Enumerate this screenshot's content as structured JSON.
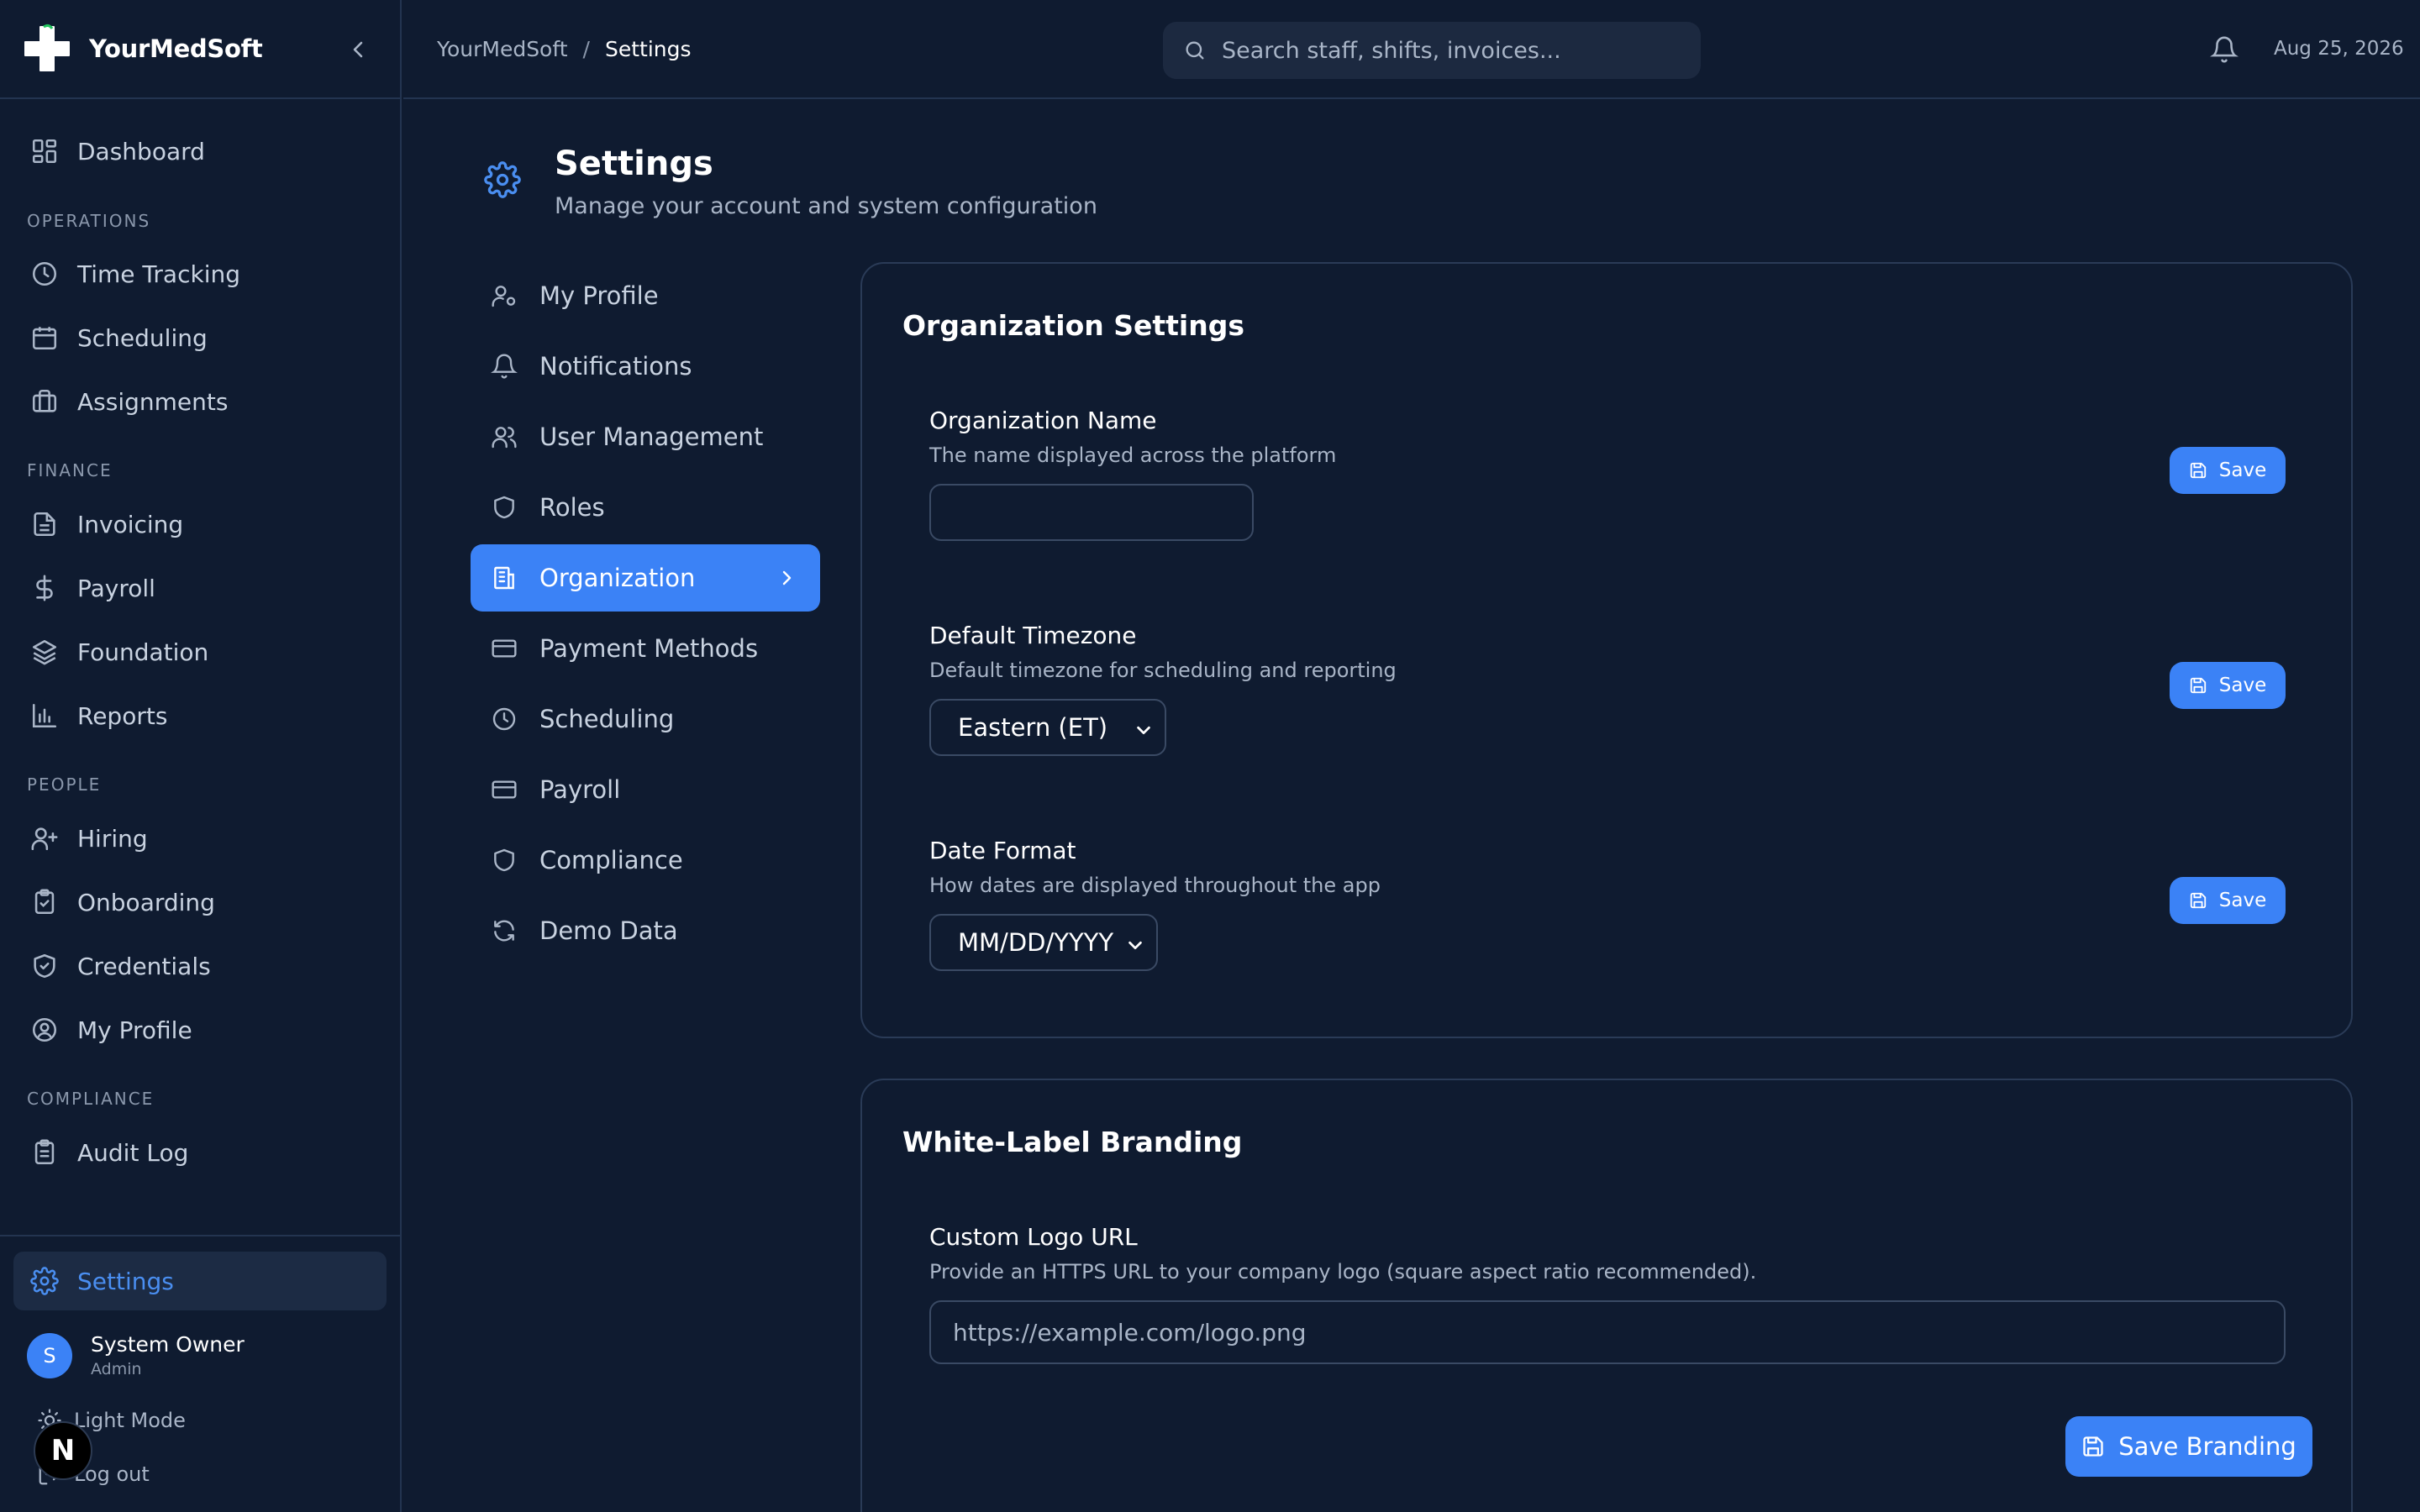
{
  "app": {
    "name": "YourMedSoft"
  },
  "sidebar": {
    "dashboard": "Dashboard",
    "sections": {
      "operations": "OPERATIONS",
      "finance": "FINANCE",
      "people": "PEOPLE",
      "compliance": "COMPLIANCE"
    },
    "items": {
      "time_tracking": "Time Tracking",
      "scheduling": "Scheduling",
      "assignments": "Assignments",
      "invoicing": "Invoicing",
      "payroll": "Payroll",
      "foundation": "Foundation",
      "reports": "Reports",
      "hiring": "Hiring",
      "onboarding": "Onboarding",
      "credentials": "Credentials",
      "my_profile": "My Profile",
      "audit_log": "Audit Log"
    },
    "settings": "Settings",
    "user": {
      "initial": "S",
      "name": "System Owner",
      "role": "Admin"
    },
    "light_mode": "Light Mode",
    "logout": "Log out",
    "dev_badge": "N"
  },
  "topbar": {
    "breadcrumb": {
      "root": "YourMedSoft",
      "separator": "/",
      "current": "Settings"
    },
    "search_placeholder": "Search staff, shifts, invoices...",
    "date": "Aug 25, 2026"
  },
  "page": {
    "title": "Settings",
    "subtitle": "Manage your account and system configuration"
  },
  "settings_nav": [
    {
      "label": "My Profile",
      "icon": "user-cog-icon"
    },
    {
      "label": "Notifications",
      "icon": "bell-icon"
    },
    {
      "label": "User Management",
      "icon": "users-icon"
    },
    {
      "label": "Roles",
      "icon": "shield-icon"
    },
    {
      "label": "Organization",
      "icon": "building-icon",
      "active": true
    },
    {
      "label": "Payment Methods",
      "icon": "credit-card-icon"
    },
    {
      "label": "Scheduling",
      "icon": "clock-icon"
    },
    {
      "label": "Payroll",
      "icon": "credit-card-icon"
    },
    {
      "label": "Compliance",
      "icon": "shield-icon"
    },
    {
      "label": "Demo Data",
      "icon": "refresh-icon"
    }
  ],
  "org_card": {
    "title": "Organization Settings",
    "name_field": {
      "label": "Organization Name",
      "help": "The name displayed across the platform",
      "value": "",
      "placeholder": ""
    },
    "timezone_field": {
      "label": "Default Timezone",
      "help": "Default timezone for scheduling and reporting",
      "value": "Eastern (ET)"
    },
    "date_field": {
      "label": "Date Format",
      "help": "How dates are displayed throughout the app",
      "value": "MM/DD/YYYY"
    },
    "save_label": "Save"
  },
  "branding_card": {
    "title": "White-Label Branding",
    "logo_field": {
      "label": "Custom Logo URL",
      "help": "Provide an HTTPS URL to your company logo (square aspect ratio recommended).",
      "placeholder": "https://example.com/logo.png"
    },
    "save_label": "Save Branding"
  },
  "colors": {
    "accent": "#3b82f6",
    "background": "#0f1b30",
    "border": "#233450"
  }
}
